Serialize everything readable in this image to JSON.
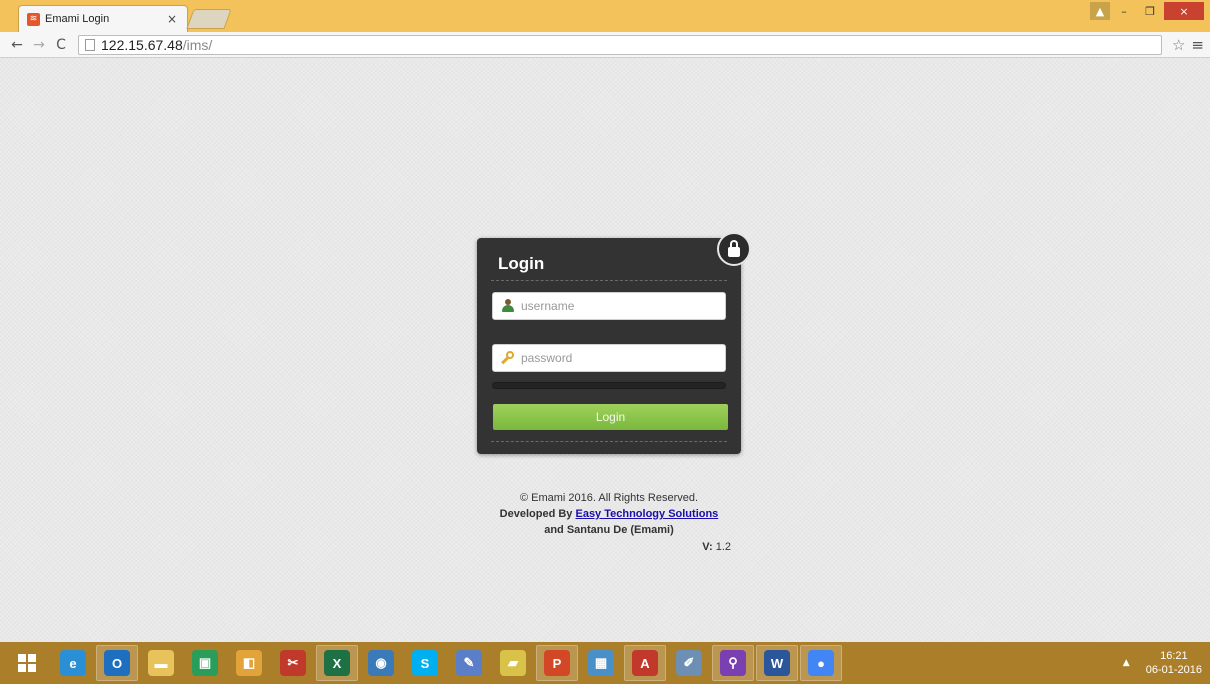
{
  "browser": {
    "tab_title": "Emami Login",
    "tab_close": "×",
    "url_host": "122.15.67.48",
    "url_path": "/ims/",
    "back": "←",
    "forward": "→",
    "reload": "C",
    "star": "☆",
    "menu": "≡",
    "window_controls": {
      "minimize": "–",
      "restore": "❐",
      "close": "×"
    }
  },
  "login": {
    "title": "Login",
    "username_placeholder": "username",
    "password_placeholder": "password",
    "button_label": "Login"
  },
  "footer": {
    "copyright": "© Emami 2016. All Rights Reserved.",
    "developed_by": "Developed By",
    "developer_link": "Easy Technology Solutions",
    "coauthor": "and Santanu De (Emami)",
    "version_label": "V:",
    "version_value": "1.2"
  },
  "taskbar": {
    "apps": [
      {
        "name": "internet-explorer",
        "glyph": "e",
        "color": "#2b8fd6"
      },
      {
        "name": "outlook",
        "glyph": "O",
        "color": "#1f6fc0"
      },
      {
        "name": "file-explorer",
        "glyph": "▬",
        "color": "#e8c25a"
      },
      {
        "name": "store",
        "glyph": "▣",
        "color": "#2a9d5a"
      },
      {
        "name": "folder",
        "glyph": "◧",
        "color": "#e2a43a"
      },
      {
        "name": "snipping-tool",
        "glyph": "✂",
        "color": "#c0392b"
      },
      {
        "name": "excel",
        "glyph": "X",
        "color": "#1e7145"
      },
      {
        "name": "app-globe",
        "glyph": "◉",
        "color": "#3a7ab8"
      },
      {
        "name": "skype",
        "glyph": "S",
        "color": "#00aff0"
      },
      {
        "name": "paint",
        "glyph": "✎",
        "color": "#5b7ec9"
      },
      {
        "name": "sticky-notes",
        "glyph": "▰",
        "color": "#d9c24a"
      },
      {
        "name": "powerpoint",
        "glyph": "P",
        "color": "#d24726"
      },
      {
        "name": "remote-desktop",
        "glyph": "▦",
        "color": "#4a90c8"
      },
      {
        "name": "acrobat",
        "glyph": "A",
        "color": "#c0392b"
      },
      {
        "name": "notepad",
        "glyph": "✐",
        "color": "#6c8fb3"
      },
      {
        "name": "search",
        "glyph": "⚲",
        "color": "#7a3fb0"
      },
      {
        "name": "word",
        "glyph": "W",
        "color": "#2b579a"
      },
      {
        "name": "chrome",
        "glyph": "●",
        "color": "#4285f4"
      }
    ],
    "time": "16:21",
    "date": "06-01-2016",
    "tray_arrow": "▲"
  }
}
